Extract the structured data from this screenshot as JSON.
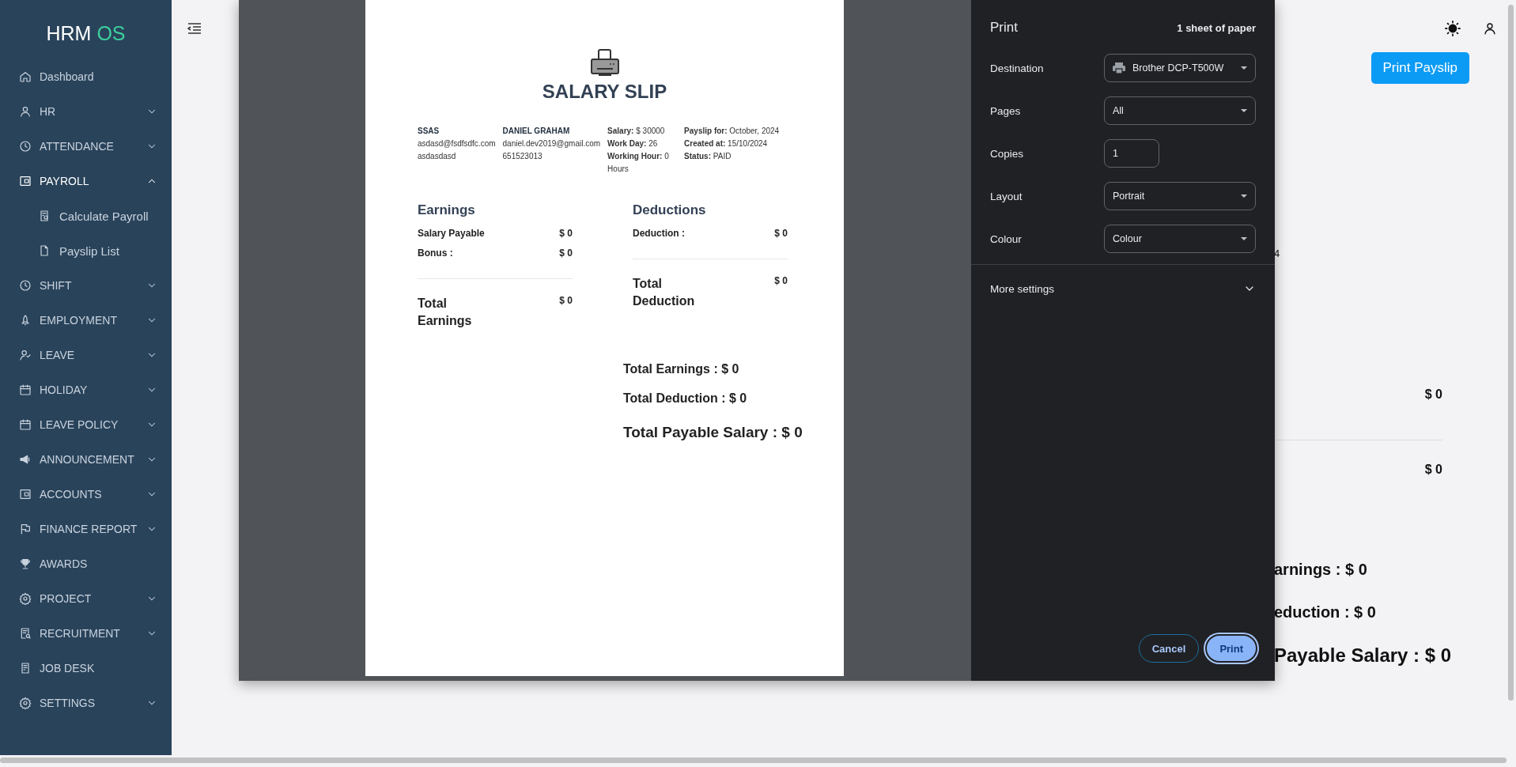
{
  "sidebar": {
    "logo": {
      "text": "HRM",
      "accent": "OS"
    },
    "items": [
      {
        "label": "Dashboard",
        "kind": "link",
        "selected": false
      },
      {
        "label": "HR",
        "kind": "group",
        "selected": false,
        "expanded": false
      },
      {
        "label": "ATTENDANCE",
        "kind": "group",
        "selected": false,
        "expanded": false
      },
      {
        "label": "PAYROLL",
        "kind": "group",
        "selected": true,
        "expanded": true,
        "children": [
          {
            "label": "Calculate Payroll",
            "selected": false
          },
          {
            "label": "Payslip List",
            "selected": false
          }
        ]
      },
      {
        "label": "SHIFT",
        "kind": "group",
        "selected": false,
        "expanded": false
      },
      {
        "label": "EMPLOYMENT",
        "kind": "group",
        "selected": false,
        "expanded": false
      },
      {
        "label": "LEAVE",
        "kind": "group",
        "selected": false,
        "expanded": false
      },
      {
        "label": "HOLIDAY",
        "kind": "group",
        "selected": false,
        "expanded": false
      },
      {
        "label": "LEAVE POLICY",
        "kind": "group",
        "selected": false,
        "expanded": false
      },
      {
        "label": "ANNOUNCEMENT",
        "kind": "group",
        "selected": false,
        "expanded": false
      },
      {
        "label": "ACCOUNTS",
        "kind": "group",
        "selected": false,
        "expanded": false
      },
      {
        "label": "FINANCE REPORT",
        "kind": "group",
        "selected": false,
        "expanded": false
      },
      {
        "label": "AWARDS",
        "kind": "link",
        "selected": false
      },
      {
        "label": "PROJECT",
        "kind": "group",
        "selected": false,
        "expanded": false
      },
      {
        "label": "RECRUITMENT",
        "kind": "group",
        "selected": false,
        "expanded": false
      },
      {
        "label": "JOB DESK",
        "kind": "link",
        "selected": false
      },
      {
        "label": "SETTINGS",
        "kind": "group",
        "selected": false,
        "expanded": false
      }
    ]
  },
  "print_payslip_button": "Print Payslip",
  "background": {
    "info_fragment": "4",
    "earnings_amount": "$ 0",
    "deduction_amount": "$ 0",
    "total_earnings": "arnings : $ 0",
    "total_deduction": "eduction : $ 0",
    "total_payable": "Payable Salary : $ 0"
  },
  "print_dialog": {
    "payslip": {
      "title": "SALARY SLIP",
      "company": [
        "SSAS",
        "asdasd@fsdfsdfc.com",
        "asdasdasd"
      ],
      "employee": [
        "DANIEL GRAHAM",
        "daniel.dev2019@gmail.com",
        "651523013"
      ],
      "work_info": [
        "**Salary:** $ 30000",
        "**Work Day:** 26",
        "**Working Hour:** 0 Hours"
      ],
      "payslip_info": [
        "**Payslip for:** October, 2024",
        "**Created at:** 15/10/2024",
        "**Status:** PAID"
      ],
      "earnings": {
        "title": "Earnings",
        "rows": [
          {
            "label": "Salary Payable",
            "amount": "$ 0"
          },
          {
            "label": "Bonus :",
            "amount": "$ 0"
          }
        ],
        "total_label": "Total Earnings",
        "total_amount": "$ 0"
      },
      "deductions": {
        "title": "Deductions",
        "rows": [
          {
            "label": "Deduction :",
            "amount": "$ 0"
          }
        ],
        "total_label": "Total Deduction",
        "total_amount": "$ 0"
      },
      "summary": [
        "Total Earnings : $ 0",
        "Total Deduction : $ 0"
      ],
      "total_payable": "Total Payable Salary : $ 0"
    },
    "title": "Print",
    "sheet_count": "1 sheet of paper",
    "settings": [
      {
        "label": "Destination",
        "kind": "destination",
        "value": "Brother DCP-T500W"
      },
      {
        "label": "Pages",
        "kind": "select",
        "value": "All"
      },
      {
        "label": "Copies",
        "kind": "input",
        "value": "1"
      },
      {
        "label": "Layout",
        "kind": "select",
        "value": "Portrait"
      },
      {
        "label": "Colour",
        "kind": "select",
        "value": "Colour"
      }
    ],
    "more_settings": {
      "label": "More settings",
      "expanded": false
    },
    "buttons": [
      {
        "label": "Cancel",
        "kind": "secondary"
      },
      {
        "label": "Print",
        "kind": "primary"
      }
    ]
  }
}
